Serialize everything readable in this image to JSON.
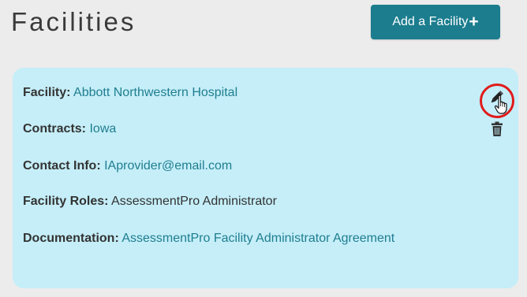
{
  "header": {
    "title": "Facilities",
    "add_button_label": "Add a Facility",
    "add_button_icon": "plus-icon"
  },
  "facility_card": {
    "facility_label": "Facility:",
    "facility_value": "Abbott Northwestern Hospital",
    "contracts_label": "Contracts:",
    "contracts_value": "Iowa",
    "contact_label": "Contact Info:",
    "contact_value": "IAprovider@email.com",
    "roles_label": "Facility Roles:",
    "roles_value": "AssessmentPro Administrator",
    "documentation_label": "Documentation:",
    "documentation_value": "AssessmentPro Facility Administrator Agreement",
    "actions": {
      "edit_icon": "pencil-icon",
      "delete_icon": "trash-icon",
      "cursor_icon": "pointer-hand-icon",
      "highlight_color": "#e01b1b"
    }
  },
  "colors": {
    "accent": "#1b7d8e",
    "card_background": "#c5eef8",
    "link": "#1f7e90",
    "page_background": "#ececec"
  }
}
